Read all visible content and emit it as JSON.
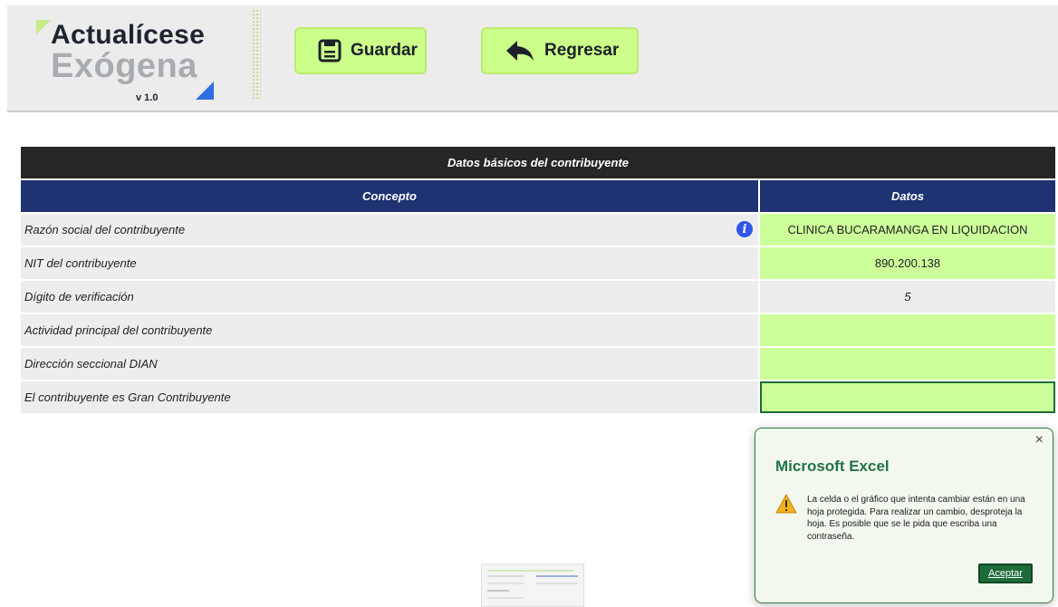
{
  "header": {
    "logo": {
      "line1": "Actualícese",
      "line2": "Exógena",
      "version": "v 1.0"
    },
    "buttons": {
      "save": "Guardar",
      "back": "Regresar"
    }
  },
  "table": {
    "title": "Datos básicos del contribuyente",
    "col_concepto": "Concepto",
    "col_datos": "Datos",
    "rows": [
      {
        "label": "Razón social del contribuyente",
        "value": "CLINICA BUCARAMANGA EN LIQUIDACION"
      },
      {
        "label": "NIT del contribuyente",
        "value": "890.200.138"
      },
      {
        "label": "Dígito de verificación",
        "value": "5"
      },
      {
        "label": "Actividad principal del contribuyente",
        "value": ""
      },
      {
        "label": "Dirección seccional DIAN",
        "value": ""
      },
      {
        "label": "El contribuyente es Gran Contribuyente",
        "value": ""
      }
    ]
  },
  "dialog": {
    "title": "Microsoft Excel",
    "message": "La celda o el gráfico que intenta cambiar están en una hoja protegida. Para realizar un cambio, desproteja la hoja. Es posible que se le pida que escriba una contraseña.",
    "ok": "Aceptar",
    "close": "×"
  },
  "colors": {
    "accent_green": "#ccff8a",
    "header_navy": "#1f3272",
    "excel_green": "#217346"
  }
}
